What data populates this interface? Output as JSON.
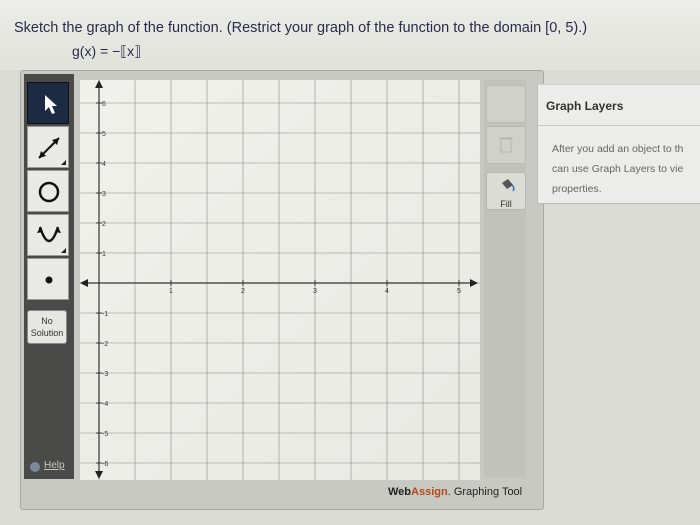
{
  "question": {
    "prompt": "Sketch the graph of the function. (Restrict your graph of the function to the domain [0, 5).)",
    "function": "g(x) = −⟦x⟧"
  },
  "toolbar": {
    "tools": [
      {
        "name": "pointer",
        "icon": "cursor-arrow-icon"
      },
      {
        "name": "line",
        "icon": "line-icon"
      },
      {
        "name": "circle",
        "icon": "circle-icon"
      },
      {
        "name": "parabola",
        "icon": "parabola-icon"
      },
      {
        "name": "point",
        "icon": "point-icon"
      }
    ],
    "no_solution_line1": "No",
    "no_solution_line2": "Solution",
    "help_label": "Help"
  },
  "graph": {
    "x_ticks": [
      "1",
      "2",
      "3",
      "4",
      "5"
    ],
    "y_ticks": [
      "6",
      "5",
      "4",
      "3",
      "2",
      "1",
      "-1",
      "-2",
      "-3",
      "-4",
      "-5",
      "-6"
    ]
  },
  "side_buttons": {
    "fill_label": "Fill"
  },
  "branding": {
    "web": "Web",
    "assign": "Assign",
    "rest": ". Graphing Tool"
  },
  "layers_panel": {
    "title": "Graph Layers",
    "line1": "After you add an object to th",
    "line2": "can use Graph Layers to vie",
    "line3": "properties."
  }
}
